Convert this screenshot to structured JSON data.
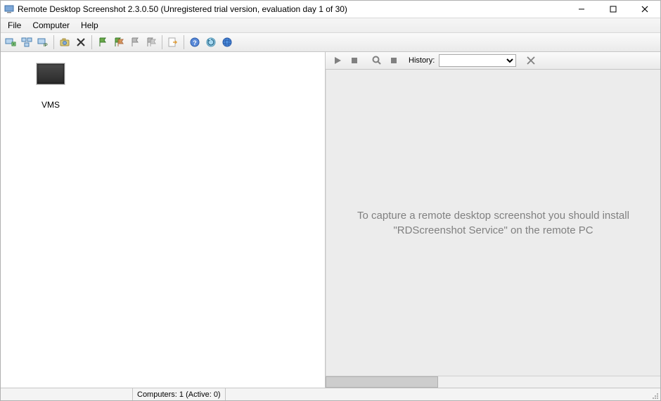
{
  "titlebar": {
    "title": "Remote Desktop Screenshot 2.3.0.50 (Unregistered trial version, evaluation day 1 of 30)"
  },
  "menu": {
    "file": "File",
    "computer": "Computer",
    "help": "Help"
  },
  "toolbar_icons": {
    "add_computer": "add-computer",
    "scan_network": "scan-network",
    "add_by_ip": "add-by-ip",
    "take_screenshot": "take-screenshot",
    "delete": "delete",
    "flag1": "flag-green",
    "flag2": "flag-multi",
    "flag3": "flag-grey",
    "flag4": "flag-grey2",
    "export": "export",
    "help": "help",
    "update": "update",
    "web": "web"
  },
  "left_pane": {
    "items": [
      {
        "label": "VMS"
      }
    ]
  },
  "right_pane": {
    "history_label": "History:",
    "history_value": "",
    "message": "To capture a remote desktop screenshot you should install \"RDScreenshot Service\" on the remote PC"
  },
  "statusbar": {
    "computers": "Computers: 1 (Active: 0)"
  }
}
